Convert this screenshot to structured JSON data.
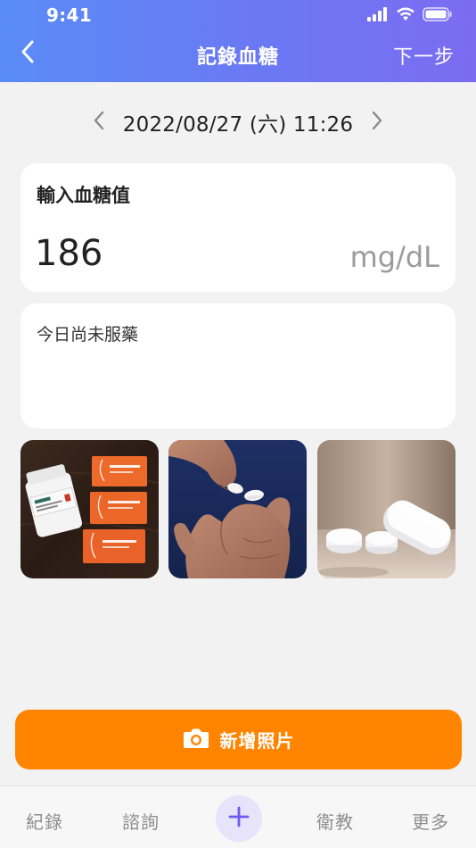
{
  "status_bar": {
    "time": "9:41",
    "icons": [
      "cellular-signal-icon",
      "wifi-icon",
      "battery-icon"
    ]
  },
  "nav": {
    "back_icon": "chevron-left-icon",
    "title": "記錄血糖",
    "next_label": "下一步"
  },
  "date": {
    "prev_icon": "chevron-left-icon",
    "value": "2022/08/27 (六) 11:26",
    "next_icon": "chevron-right-icon"
  },
  "glucose": {
    "label": "輸入血糖值",
    "value": "186",
    "unit": "mg/dL"
  },
  "note": {
    "text": "今日尚未服藥"
  },
  "photos": [
    {
      "name": "medicine-boxes-photo"
    },
    {
      "name": "pills-in-hand-photo"
    },
    {
      "name": "white-tablets-photo"
    }
  ],
  "add_photo": {
    "icon": "camera-icon",
    "label": "新增照片"
  },
  "tab_bar": {
    "record": "紀錄",
    "consult": "諮詢",
    "add_icon": "plus-icon",
    "education": "衛教",
    "more": "更多"
  },
  "colors": {
    "header_gradient_start": "#5a8cf6",
    "header_gradient_end": "#7b6cf1",
    "accent_orange": "#ff8500",
    "tab_add_bg": "#e6e3fb",
    "tab_add_icon": "#6a5cf0"
  }
}
